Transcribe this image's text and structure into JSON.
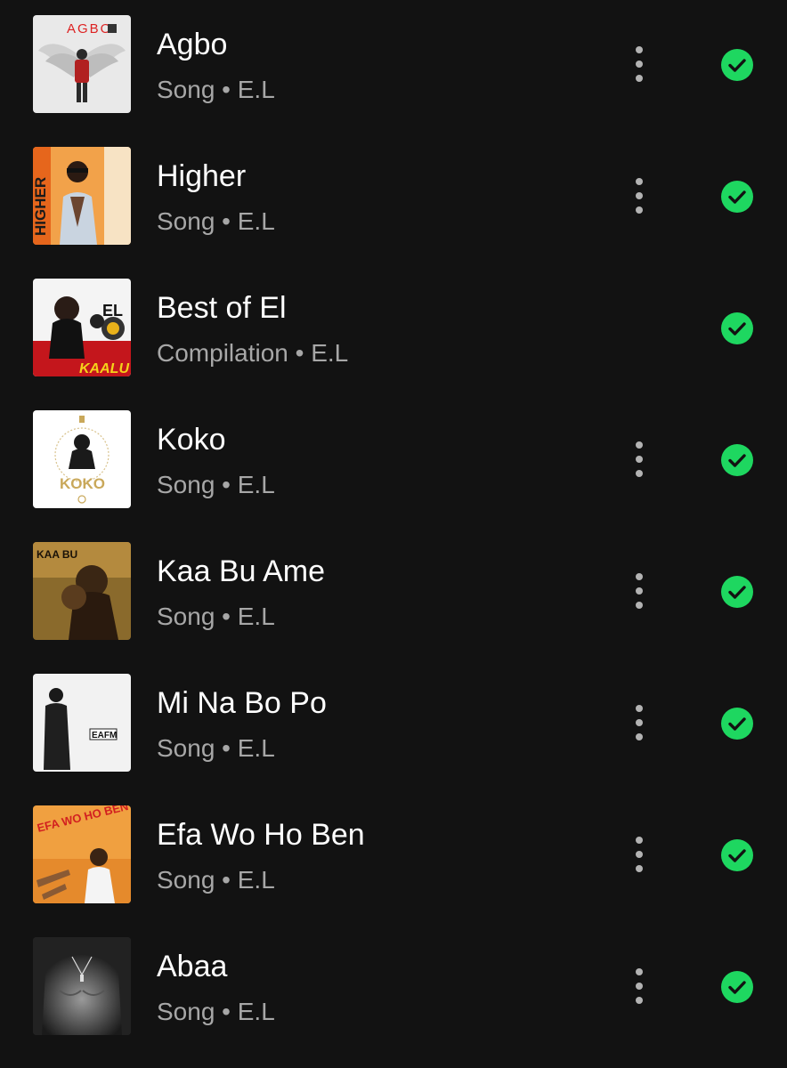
{
  "colors": {
    "background": "#121212",
    "title": "#ffffff",
    "subtitle": "#a7a7a7",
    "downloaded_accent": "#1ed760",
    "more_dots": "#b3b3b3"
  },
  "tracks": [
    {
      "title": "Agbo",
      "subtitle": "Song • E.L",
      "has_more_menu": true,
      "downloaded": true,
      "cover_icon": "agbo-cover"
    },
    {
      "title": "Higher",
      "subtitle": "Song • E.L",
      "has_more_menu": true,
      "downloaded": true,
      "cover_icon": "higher-cover"
    },
    {
      "title": "Best of El",
      "subtitle": "Compilation • E.L",
      "has_more_menu": false,
      "downloaded": true,
      "cover_icon": "best-of-el-cover"
    },
    {
      "title": "Koko",
      "subtitle": "Song • E.L",
      "has_more_menu": true,
      "downloaded": true,
      "cover_icon": "koko-cover"
    },
    {
      "title": "Kaa Bu Ame",
      "subtitle": "Song • E.L",
      "has_more_menu": true,
      "downloaded": true,
      "cover_icon": "kaa-bu-ame-cover"
    },
    {
      "title": "Mi Na Bo Po",
      "subtitle": "Song • E.L",
      "has_more_menu": true,
      "downloaded": true,
      "cover_icon": "mi-na-bo-po-cover"
    },
    {
      "title": "Efa Wo Ho Ben",
      "subtitle": "Song • E.L",
      "has_more_menu": true,
      "downloaded": true,
      "cover_icon": "efa-wo-ho-ben-cover"
    },
    {
      "title": "Abaa",
      "subtitle": "Song • E.L",
      "has_more_menu": true,
      "downloaded": true,
      "cover_icon": "abaa-cover"
    }
  ],
  "cover_text": {
    "agbo": "AGBO",
    "higher": "HIGHER",
    "best_of_el": "EL",
    "best_of_el_bottom": "KAALU",
    "koko": "KOKO",
    "kaa_bu_ame": "KAA BU",
    "mi_na_bo_po": "EAFM",
    "efa_wo_ho_ben": "EFA WO HO BEN?"
  }
}
